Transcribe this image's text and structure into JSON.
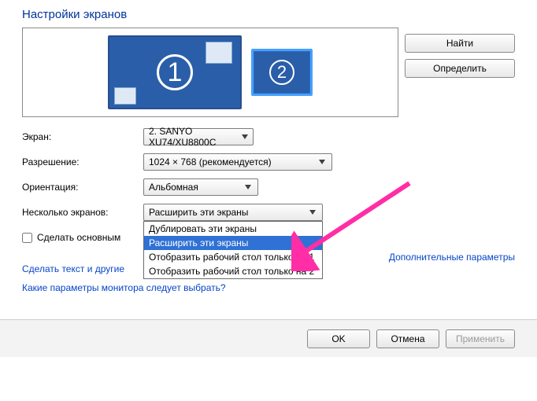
{
  "title": "Настройки экранов",
  "preview": {
    "monitor1": "1",
    "monitor2": "2"
  },
  "side_buttons": {
    "find": "Найти",
    "identify": "Определить"
  },
  "labels": {
    "display": "Экран:",
    "resolution": "Разрешение:",
    "orientation": "Ориентация:",
    "multiple": "Несколько экранов:",
    "make_main": "Сделать основным"
  },
  "values": {
    "display": "2. SANYO XU74/XU8800C",
    "resolution": "1024 × 768 (рекомендуется)",
    "orientation": "Альбомная",
    "multiple": "Расширить эти экраны"
  },
  "multiple_options": [
    "Дублировать эти экраны",
    "Расширить эти экраны",
    "Отобразить рабочий стол только на 1",
    "Отобразить рабочий стол только на 2"
  ],
  "links": {
    "advanced": "Дополнительные параметры",
    "text_size": "Сделать текст и другие",
    "which_params": "Какие параметры монитора следует выбрать?"
  },
  "footer": {
    "ok": "OK",
    "cancel": "Отмена",
    "apply": "Применить"
  }
}
